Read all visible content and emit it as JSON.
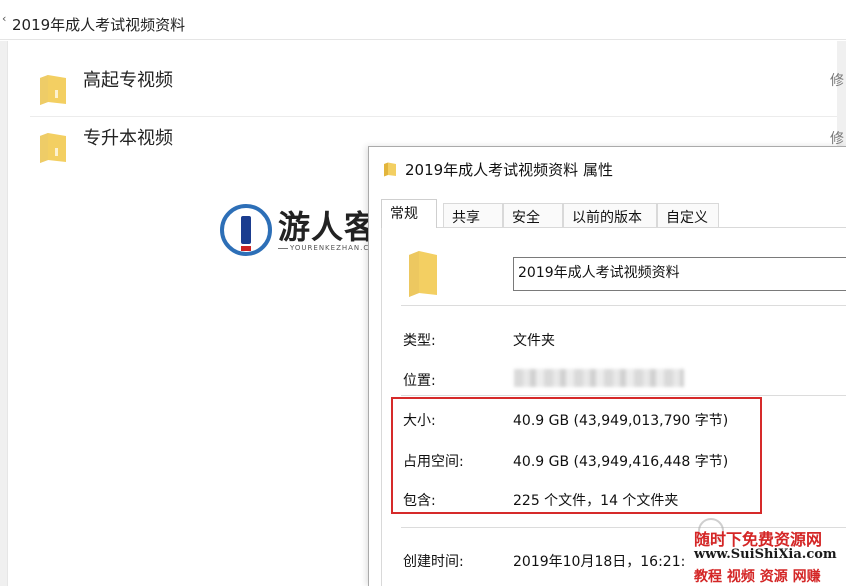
{
  "explorer": {
    "address_path": "2019年成人考试视频资料",
    "files": [
      {
        "name": "高起专视频",
        "meta": "修"
      },
      {
        "name": "专升本视频",
        "meta": "修"
      }
    ]
  },
  "watermark_logo": {
    "cn": "游人客栈",
    "en": "YOURENKEZHAN.COM"
  },
  "dialog": {
    "title": "2019年成人考试视频资料 属性",
    "tabs": [
      {
        "label": "常规",
        "active": true
      },
      {
        "label": "共享",
        "active": false
      },
      {
        "label": "安全",
        "active": false
      },
      {
        "label": "以前的版本",
        "active": false
      },
      {
        "label": "自定义",
        "active": false
      }
    ],
    "folder_name": "2019年成人考试视频资料",
    "properties": {
      "type": {
        "label": "类型:",
        "value": "文件夹"
      },
      "location": {
        "label": "位置:",
        "value": ""
      },
      "size": {
        "label": "大小:",
        "value": "40.9 GB (43,949,013,790 字节)"
      },
      "size_on_disk": {
        "label": "占用空间:",
        "value": "40.9 GB (43,949,416,448 字节)"
      },
      "contains": {
        "label": "包含:",
        "value": "225 个文件，14 个文件夹"
      },
      "created": {
        "label": "创建时间:",
        "value": "2019年10月18日，16:21:"
      }
    }
  },
  "site_watermark": {
    "line1": "随时下免费资源网",
    "line2": "www.SuiShiXia.com",
    "line3": "教程 视频 资源 网赚"
  },
  "colors": {
    "highlight_box": "#d62a2a",
    "folder_yellow": "#f3cf62",
    "folder_dark": "#e2b53c"
  }
}
